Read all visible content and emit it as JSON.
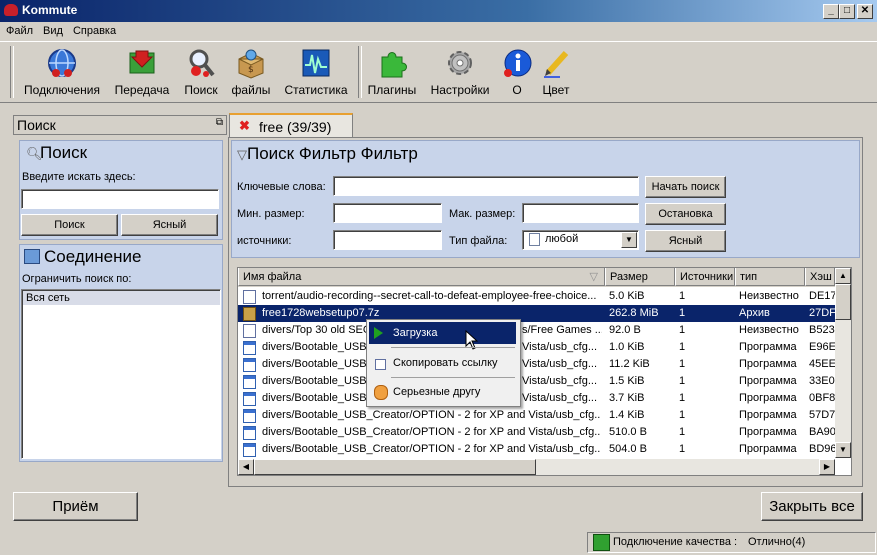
{
  "window": {
    "title": "Kommute"
  },
  "menu": [
    "Файл",
    "Вид",
    "Справка"
  ],
  "toolbar": {
    "items": [
      {
        "label": "Подключения",
        "icon": "globe-network-icon"
      },
      {
        "label": "Передача",
        "icon": "transfer-arrows-icon"
      },
      {
        "label": "Поиск",
        "icon": "magnifier-icon"
      },
      {
        "label": "файлы",
        "icon": "files-box-icon"
      },
      {
        "label": "Статистика",
        "icon": "statistics-graph-icon"
      },
      {
        "label": "Плагины",
        "icon": "puzzle-icon"
      },
      {
        "label": "Настройки",
        "icon": "gear-icon"
      },
      {
        "label": "О",
        "icon": "info-icon"
      },
      {
        "label": "Цвет",
        "icon": "pencil-color-icon"
      }
    ]
  },
  "left": {
    "panel_title": "Поиск",
    "search": {
      "heading": "Поиск",
      "prompt": "Введите искать здесь:",
      "value": "",
      "search_button": "Поиск",
      "clear_button": "Ясный"
    },
    "connection": {
      "heading": "Соединение",
      "limit_label": "Ограничить поиск по:",
      "selected": "Вся сеть"
    }
  },
  "tab": {
    "label": "free (39/39)"
  },
  "filter": {
    "heading": "Поиск Фильтр Фильтр",
    "keywords_label": "Ключевые слова:",
    "keywords_value": "",
    "min_size_label": "Мин. размер:",
    "min_size_value": "",
    "max_size_label": "Мак. размер:",
    "max_size_value": "",
    "sources_label": "источники:",
    "sources_value": "",
    "filetype_label": "Тип файла:",
    "filetype_value": "любой",
    "start_button": "Начать поиск",
    "stop_button": "Остановка",
    "clear_button": "Ясный"
  },
  "table": {
    "columns": [
      "Имя файла",
      "Размер",
      "Источники",
      "тип",
      "Хэш"
    ],
    "rows": [
      {
        "name": "torrent/audio-recording--secret-call-to-defeat-employee-free-choice...",
        "size": "5.0 KiB",
        "sources": "1",
        "type": "Неизвестно",
        "hash": "DE17",
        "icon": "document-icon"
      },
      {
        "name": "free1728websetup07.7z",
        "size": "262.8 MiB",
        "sources": "1",
        "type": "Архив",
        "hash": "27DF",
        "icon": "archive-icon",
        "selected": true
      },
      {
        "name": "divers/Top 30 old SEG",
        "name_tail": "s/Free Games ...",
        "size": "92.0 B",
        "sources": "1",
        "type": "Неизвестно",
        "hash": "B523",
        "icon": "document-icon"
      },
      {
        "name": "divers/Bootable_USB_",
        "name_tail": "Vista/usb_cfg...",
        "size": "1.0 KiB",
        "sources": "1",
        "type": "Программа",
        "hash": "E96E",
        "icon": "program-icon"
      },
      {
        "name": "divers/Bootable_USB_",
        "name_tail": "Vista/usb_cfg...",
        "size": "11.2 KiB",
        "sources": "1",
        "type": "Программа",
        "hash": "45EE",
        "icon": "program-icon"
      },
      {
        "name": "divers/Bootable_USB_",
        "name_tail": "Vista/usb_cfg...",
        "size": "1.5 KiB",
        "sources": "1",
        "type": "Программа",
        "hash": "33E0",
        "icon": "program-icon"
      },
      {
        "name": "divers/Bootable_USB_",
        "name_tail": "Vista/usb_cfg...",
        "size": "3.7 KiB",
        "sources": "1",
        "type": "Программа",
        "hash": "0BF8",
        "icon": "program-icon"
      },
      {
        "name": "divers/Bootable_USB_Creator/OPTION - 2 for XP and Vista/usb_cfg...",
        "size": "1.4 KiB",
        "sources": "1",
        "type": "Программа",
        "hash": "57D7",
        "icon": "program-icon"
      },
      {
        "name": "divers/Bootable_USB_Creator/OPTION - 2 for XP and Vista/usb_cfg...",
        "size": "510.0 B",
        "sources": "1",
        "type": "Программа",
        "hash": "BA90",
        "icon": "program-icon"
      },
      {
        "name": "divers/Bootable_USB_Creator/OPTION - 2 for XP and Vista/usb_cfg...",
        "size": "504.0 B",
        "sources": "1",
        "type": "Программа",
        "hash": "BD96",
        "icon": "program-icon"
      }
    ]
  },
  "context_menu": {
    "items": [
      "Загрузка",
      "Скопировать ссылку",
      "Серьезные другу"
    ]
  },
  "bottom": {
    "receive_button": "Приём",
    "close_all_button": "Закрыть все"
  },
  "status": {
    "connection_quality": "Подключение качества :",
    "quality_value": "Отлично(4)"
  }
}
